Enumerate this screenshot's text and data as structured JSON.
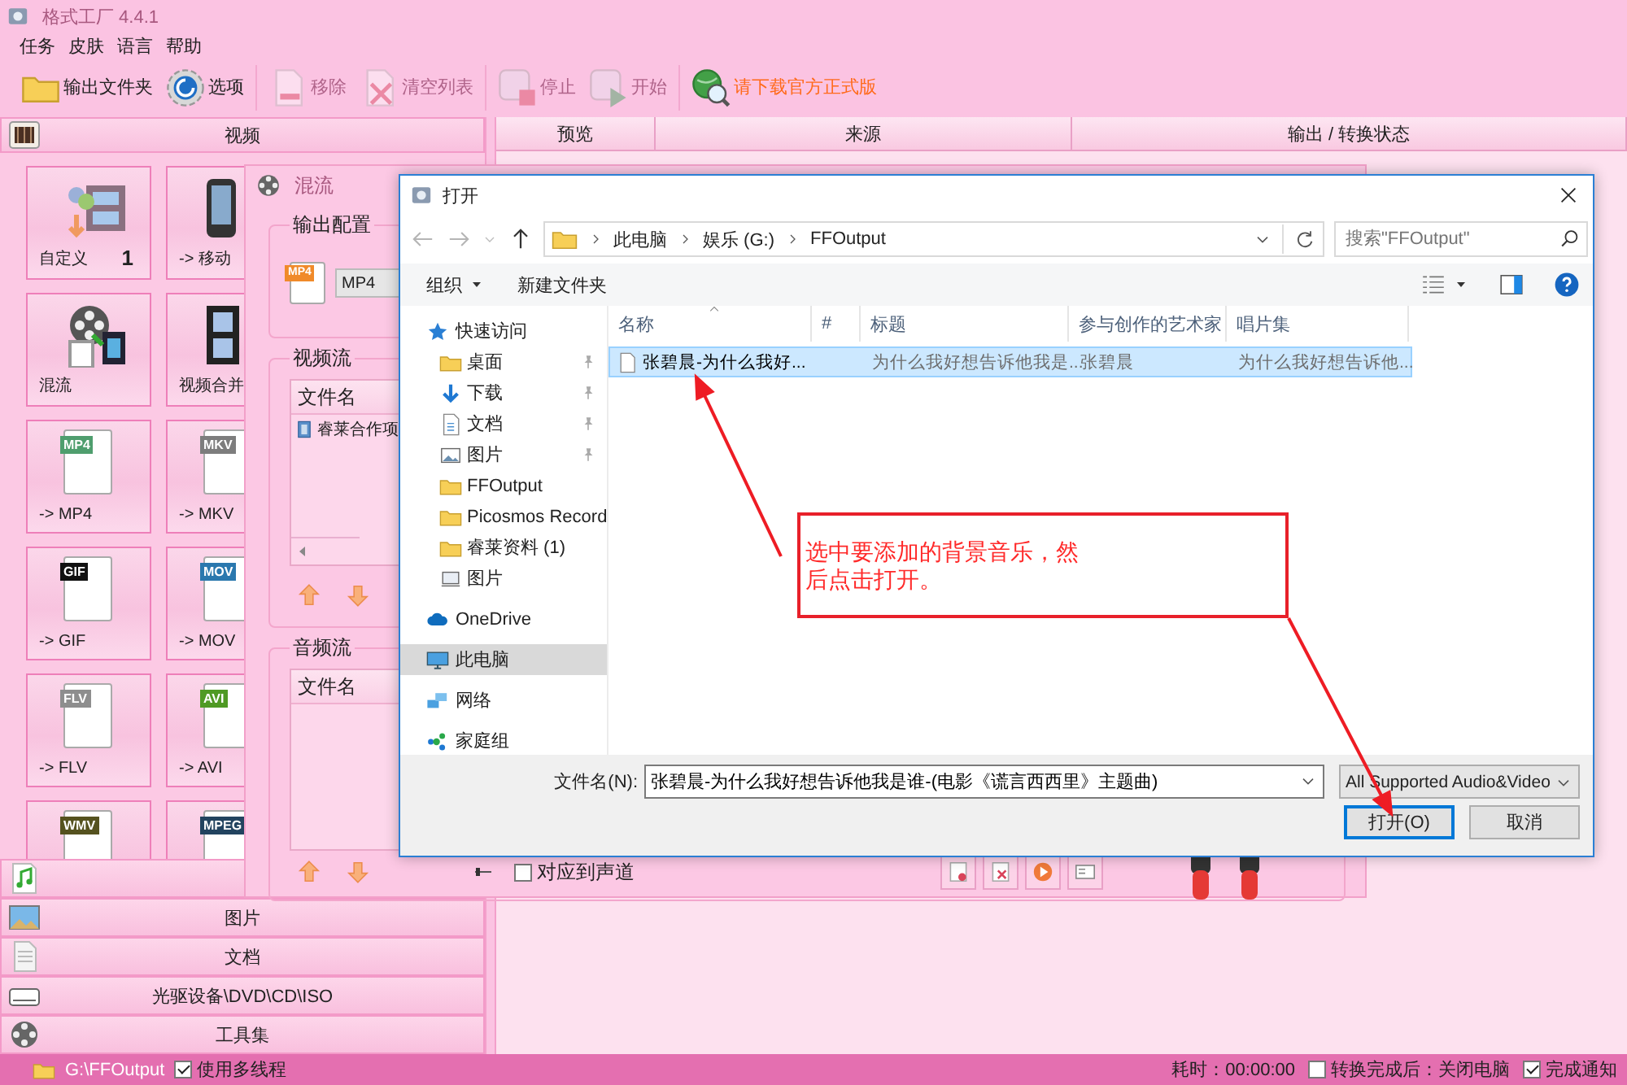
{
  "window": {
    "title": "格式工厂 4.4.1"
  },
  "menu": [
    "任务",
    "皮肤",
    "语言",
    "帮助"
  ],
  "toolbar": [
    [
      {
        "label": "输出文件夹",
        "kind": "folder",
        "disabled": false
      },
      {
        "label": "选项",
        "kind": "gear",
        "disabled": false
      }
    ],
    [
      {
        "label": "移除",
        "kind": "remove",
        "disabled": true
      },
      {
        "label": "清空列表",
        "kind": "clear",
        "disabled": true
      }
    ],
    [
      {
        "label": "停止",
        "kind": "stop",
        "disabled": true
      },
      {
        "label": "开始",
        "kind": "start",
        "disabled": true
      }
    ],
    [
      {
        "label": "请下载官方正式版",
        "kind": "download",
        "disabled": false
      }
    ]
  ],
  "sidebar": {
    "header": {
      "label": "视频",
      "kind": "video"
    },
    "tiles": [
      {
        "label": "自定义",
        "count": "1",
        "kind": "custom"
      },
      {
        "label": "-> 移动",
        "kind": "mobile"
      },
      {
        "label": "混流",
        "kind": "mux"
      },
      {
        "label": "视频合并",
        "kind": "join"
      },
      {
        "label": "-> MP4",
        "kind": "format",
        "badge": "MP4",
        "color": "#4f9e6e"
      },
      {
        "label": "-> MKV",
        "kind": "format",
        "badge": "MKV",
        "color": "#7d7d7d"
      },
      {
        "label": "-> GIF",
        "kind": "format",
        "badge": "GIF",
        "color": "#111111"
      },
      {
        "label": "-> MOV",
        "kind": "format",
        "badge": "MOV",
        "color": "#2a78ae"
      },
      {
        "label": "-> FLV",
        "kind": "format",
        "badge": "FLV",
        "color": "#8e8e8e"
      },
      {
        "label": "-> AVI",
        "kind": "format",
        "badge": "AVI",
        "color": "#4f9a24"
      },
      {
        "kind": "format",
        "badge": "WMV",
        "color": "#55521f"
      },
      {
        "kind": "format",
        "badge": "MPEG",
        "color": "#22435f"
      }
    ],
    "categories": [
      {
        "kind": "audio"
      },
      {
        "label": "图片",
        "kind": "image"
      },
      {
        "label": "文档",
        "kind": "document"
      },
      {
        "label": "光驱设备\\DVD\\CD\\ISO",
        "kind": "disc"
      },
      {
        "label": "工具集",
        "kind": "tools"
      }
    ]
  },
  "task_list": {
    "columns": [
      "预览",
      "来源",
      "输出 / 转换状态"
    ]
  },
  "status_bar": {
    "output_folder": "G:\\FFOutput",
    "multithread": {
      "label": "使用多线程",
      "checked": true
    },
    "elapsed": "耗时：00:00:00",
    "shutdown": {
      "label": "转换完成后：关闭电脑",
      "checked": false
    },
    "notify": {
      "label": "完成通知",
      "checked": true
    }
  },
  "mux_dialog": {
    "title": "混流",
    "output": {
      "legend": "输出配置",
      "badge": "MP4",
      "format": "MP4"
    },
    "video": {
      "legend": "视频流",
      "column": "文件名",
      "items": [
        "睿莱合作项"
      ]
    },
    "audio": {
      "legend": "音频流",
      "column": "文件名"
    },
    "channel": {
      "label": "对应到声道",
      "checked": false
    }
  },
  "open_dialog": {
    "title": "打开",
    "breadcrumb": [
      "此电脑",
      "娱乐 (G:)",
      "FFOutput"
    ],
    "search": {
      "placeholder": "搜索\"FFOutput\""
    },
    "toolbar": [
      {
        "label": "组织",
        "kind": "menu"
      },
      {
        "label": "新建文件夹",
        "kind": "plain"
      }
    ],
    "nav": [
      {
        "label": "快速访问",
        "kind": "star",
        "selected": false,
        "children": [
          {
            "label": "桌面",
            "kind": "folder",
            "pinned": true,
            "selected": false
          },
          {
            "label": "下载",
            "kind": "download",
            "pinned": true,
            "selected": false
          },
          {
            "label": "文档",
            "kind": "document",
            "pinned": true,
            "selected": false
          },
          {
            "label": "图片",
            "kind": "picture",
            "pinned": true,
            "selected": false
          },
          {
            "label": "FFOutput",
            "kind": "folder",
            "pinned": false,
            "selected": false
          },
          {
            "label": "Picosmos Record",
            "kind": "folder",
            "pinned": false,
            "selected": false
          },
          {
            "label": "睿莱资料 (1)",
            "kind": "folder",
            "pinned": false,
            "selected": false
          },
          {
            "label": "图片",
            "kind": "screen",
            "pinned": false,
            "selected": false
          }
        ]
      },
      {
        "label": "OneDrive",
        "kind": "cloud",
        "selected": false
      },
      {
        "label": "此电脑",
        "kind": "pc",
        "selected": true
      },
      {
        "label": "网络",
        "kind": "network",
        "selected": false
      },
      {
        "label": "家庭组",
        "kind": "homegroup",
        "selected": false
      }
    ],
    "columns": [
      "名称",
      "#",
      "标题",
      "参与创作的艺术家",
      "唱片集"
    ],
    "files": [
      {
        "cells": [
          "张碧晨-为什么我好...",
          "",
          "为什么我好想告诉他我是...",
          "张碧晨",
          "为什么我好想告诉他..."
        ],
        "selected": true
      }
    ],
    "file_name": {
      "label": "文件名(N):",
      "value": "张碧晨-为什么我好想告诉他我是谁-(电影《谎言西西里》主题曲)"
    },
    "file_type": "All Supported Audio&Video",
    "buttons": [
      {
        "label": "打开(O)",
        "default": true
      },
      {
        "label": "取消",
        "default": false
      }
    ]
  },
  "annotation": {
    "text": "选中要添加的背景音乐，然后点击打开。"
  }
}
